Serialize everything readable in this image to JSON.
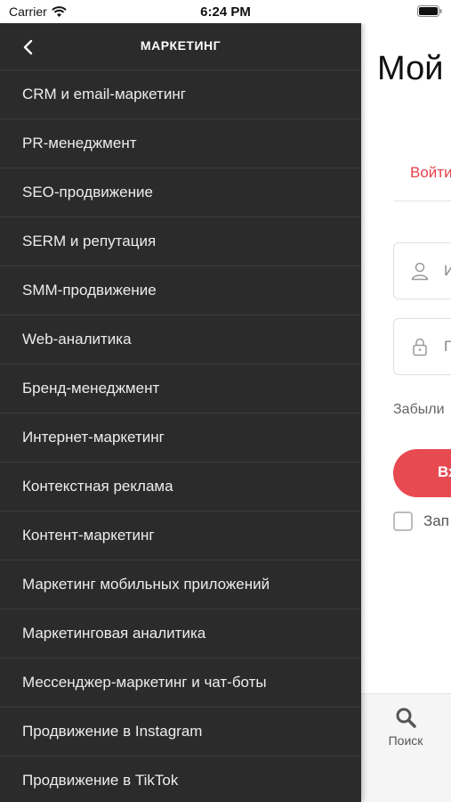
{
  "status_bar": {
    "carrier": "Carrier",
    "time": "6:24 PM"
  },
  "drawer": {
    "title": "МАРКЕТИНГ",
    "items": [
      "CRM и email-маркетинг",
      "PR-менеджмент",
      "SEO-продвижение",
      "SERM и репутация",
      "SMM-продвижение",
      "Web-аналитика",
      "Бренд-менеджмент",
      "Интернет-маркетинг",
      "Контекстная реклама",
      "Контент-маркетинг",
      "Маркетинг мобильных приложений",
      "Маркетинговая аналитика",
      "Мессенджер-маркетинг и чат-боты",
      "Продвижение в Instagram",
      "Продвижение в TikTok"
    ]
  },
  "page": {
    "title": "Мой",
    "login_tab": "Войти",
    "login_placeholder": "И",
    "password_placeholder": "П",
    "forgot_link": "Забыли",
    "submit_label": "Вх",
    "remember_label": "Зап"
  },
  "tab_bar": {
    "search_label": "Поиск"
  },
  "colors": {
    "accent": "#e84a52",
    "drawer_bg": "#2b2b2b",
    "divider": "#3c3c3c"
  }
}
